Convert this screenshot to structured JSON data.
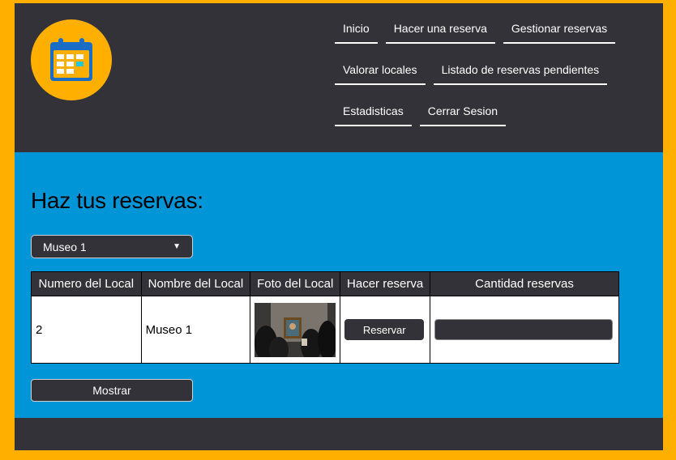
{
  "colors": {
    "frame": "#ffaf00",
    "dark": "#333238",
    "main_bg": "#0095d6",
    "logo_bg": "#ffaf00",
    "calendar": "#1a6cc4"
  },
  "logo": {
    "icon": "calendar-icon"
  },
  "nav": {
    "row1": [
      "Inicio",
      "Hacer una reserva",
      "Gestionar reservas"
    ],
    "row2": [
      "Valorar locales",
      "Listado de reservas pendientes"
    ],
    "row3": [
      "Estadisticas",
      "Cerrar Sesion"
    ]
  },
  "main": {
    "title": "Haz tus reservas:",
    "select": {
      "selected": "Museo 1"
    },
    "table": {
      "headers": [
        "Numero del Local",
        "Nombre del Local",
        "Foto del Local",
        "Hacer reserva",
        "Cantidad reservas"
      ],
      "rows": [
        {
          "numero": "2",
          "nombre": "Museo 1",
          "foto": "museum-photo",
          "boton": "Reservar",
          "cantidad": ""
        }
      ]
    },
    "show_button": "Mostrar"
  }
}
